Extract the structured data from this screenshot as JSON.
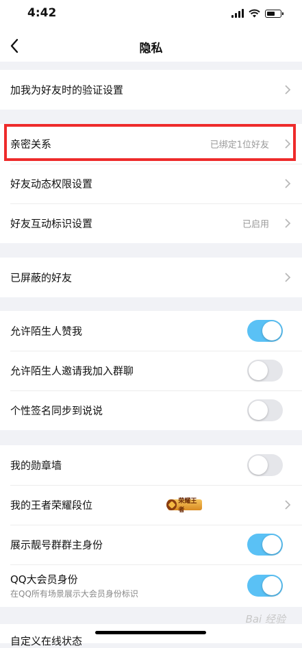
{
  "status": {
    "time": "4:42"
  },
  "nav": {
    "title": "隐私"
  },
  "groups": {
    "g1": {
      "verify": "加我为好友时的验证设置"
    },
    "g2": {
      "intimate": {
        "label": "亲密关系",
        "value": "已绑定1位好友"
      },
      "moments": "好友动态权限设置",
      "interaction": {
        "label": "好友互动标识设置",
        "value": "已启用"
      }
    },
    "g3": {
      "blocked": "已屏蔽的好友"
    },
    "g4": {
      "allow_like": {
        "label": "允许陌生人赞我",
        "on": true
      },
      "allow_invite": {
        "label": "允许陌生人邀请我加入群聊",
        "on": false
      },
      "sig_sync": {
        "label": "个性签名同步到说说",
        "on": false
      }
    },
    "g5": {
      "medal": {
        "label": "我的勋章墙",
        "on": false
      },
      "kings": {
        "label": "我的王者荣耀段位",
        "badge": "荣耀王者"
      },
      "pretty": {
        "label": "展示靓号群群主身份",
        "on": true
      },
      "vip": {
        "label": "QQ大会员身份",
        "sub": "在QQ所有场景展示大会员身份标识",
        "on": true
      }
    },
    "partial": "自定义在线状态"
  },
  "colors": {
    "toggle_on": "#5ac1f5",
    "highlight": "#ee2b2b"
  },
  "watermark": "Bai 经验"
}
